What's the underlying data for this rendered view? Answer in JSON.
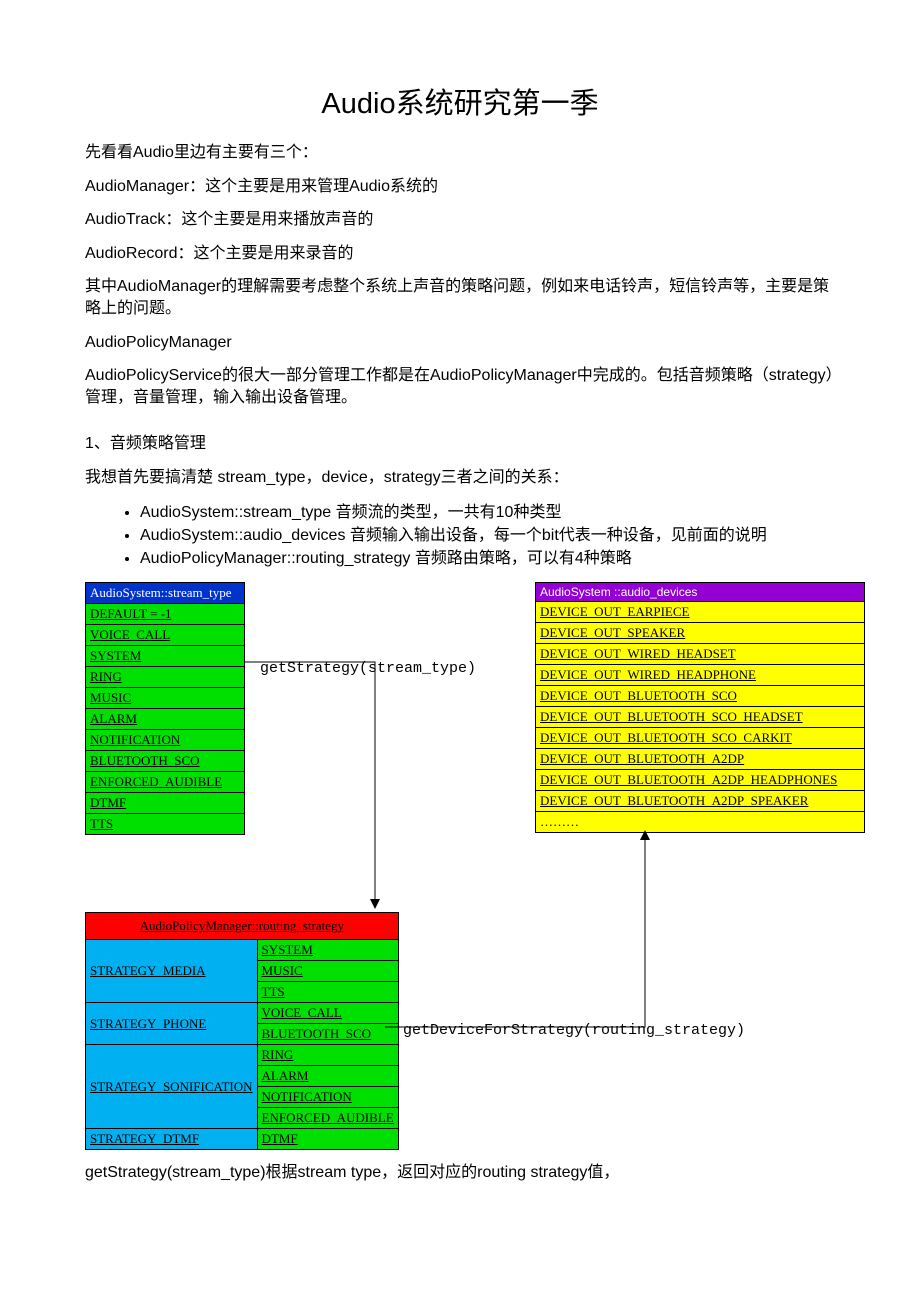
{
  "title": "Audio系统研究第一季",
  "para1": "先看看Audio里边有主要有三个：",
  "para2": "AudioManager：这个主要是用来管理Audio系统的",
  "para3": " AudioTrack：这个主要是用来播放声音的",
  "para4": " AudioRecord：这个主要是用来录音的",
  "para5": "其中AudioManager的理解需要考虑整个系统上声音的策略问题，例如来电话铃声，短信铃声等，主要是策略上的问题。",
  "para6": "AudioPolicyManager",
  "para7": " AudioPolicyService的很大一部分管理工作都是在AudioPolicyManager中完成的。包括音频策略（strategy）管理，音量管理，输入输出设备管理。",
  "sec1_title": "1、音频策略管理",
  "sec1_p1": " 我想首先要搞清楚 stream_type，device，strategy三者之间的关系：",
  "bullets": [
    "AudioSystem::stream_type  音频流的类型，一共有10种类型",
    "AudioSystem::audio_devices  音频输入输出设备，每一个bit代表一种设备，见前面的说明",
    "AudioPolicyManager::routing_strategy 音频路由策略，可以有4种策略"
  ],
  "stream_header": "AudioSystem::stream_type",
  "stream_rows": [
    "DEFAULT = -1",
    "VOICE_CALL",
    "SYSTEM",
    "RING",
    "MUSIC",
    "ALARM",
    "NOTIFICATION",
    "BLUETOOTH_SCO",
    "ENFORCED_AUDIBLE",
    "DTMF",
    "TTS"
  ],
  "dev_header": "AudioSystem ::audio_devices",
  "dev_rows": [
    "DEVICE_OUT_EARPIECE",
    "DEVICE_OUT_SPEAKER",
    "DEVICE_OUT_WIRED_HEADSET",
    "DEVICE_OUT_WIRED_HEADPHONE",
    "DEVICE_OUT_BLUETOOTH_SCO",
    "DEVICE_OUT_BLUETOOTH_SCO_HEADSET",
    "DEVICE_OUT_BLUETOOTH_SCO_CARKIT",
    "DEVICE_OUT_BLUETOOTH_A2DP",
    "DEVICE_OUT_BLUETOOTH_A2DP_HEADPHONES",
    "DEVICE_OUT_BLUETOOTH_A2DP_SPEAKER"
  ],
  "dev_dots": "………",
  "rt_header": "AudioPolicyManager::routing_strategy",
  "rt_rows": [
    {
      "strategy": "STRATEGY_MEDIA",
      "items": [
        "SYSTEM",
        "MUSIC",
        "TTS"
      ]
    },
    {
      "strategy": "STRATEGY_PHONE",
      "items": [
        "VOICE_CALL",
        "BLUETOOTH_SCO"
      ]
    },
    {
      "strategy": "STRATEGY_SONIFICATION",
      "items": [
        "RING",
        "ALARM",
        "NOTIFICATION",
        "ENFORCED_AUDIBLE"
      ]
    },
    {
      "strategy": "STRATEGY_DTMF",
      "items": [
        "DTMF"
      ]
    }
  ],
  "fn1": "getStrategy(stream_type)",
  "fn2": "getDeviceForStrategy(routing_strategy)",
  "bottom": "getStrategy(stream_type)根据stream type，返回对应的routing strategy值，"
}
